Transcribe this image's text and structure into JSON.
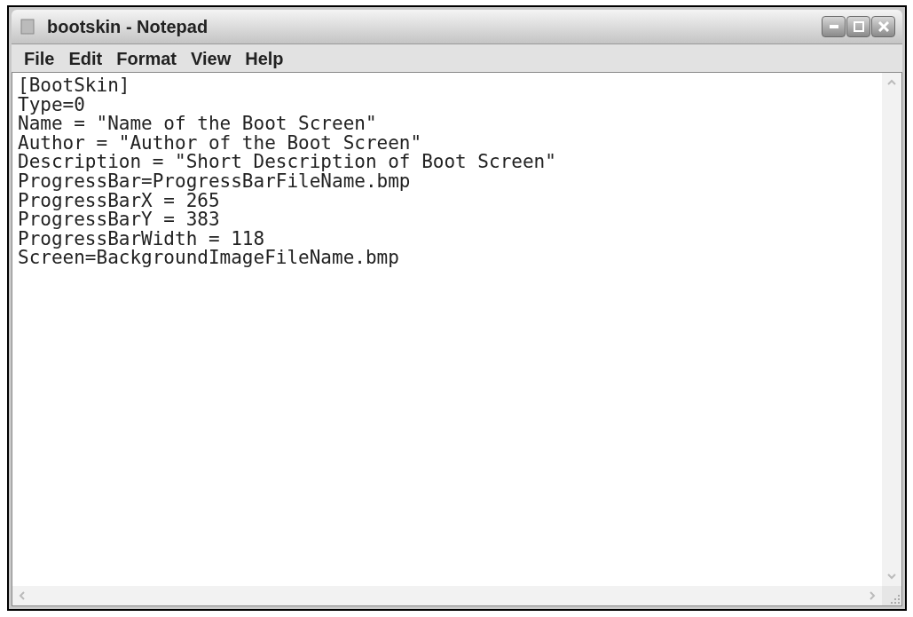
{
  "window": {
    "title": "bootskin - Notepad"
  },
  "menu": [
    {
      "label": "File"
    },
    {
      "label": "Edit"
    },
    {
      "label": "Format"
    },
    {
      "label": "View"
    },
    {
      "label": "Help"
    }
  ],
  "document": {
    "lines": [
      "[BootSkin]",
      "Type=0",
      "Name = \"Name of the Boot Screen\"",
      "Author = \"Author of the Boot Screen\"",
      "Description = \"Short Description of Boot Screen\"",
      "ProgressBar=ProgressBarFileName.bmp",
      "ProgressBarX = 265",
      "ProgressBarY = 383",
      "ProgressBarWidth = 118",
      "Screen=BackgroundImageFileName.bmp"
    ]
  }
}
